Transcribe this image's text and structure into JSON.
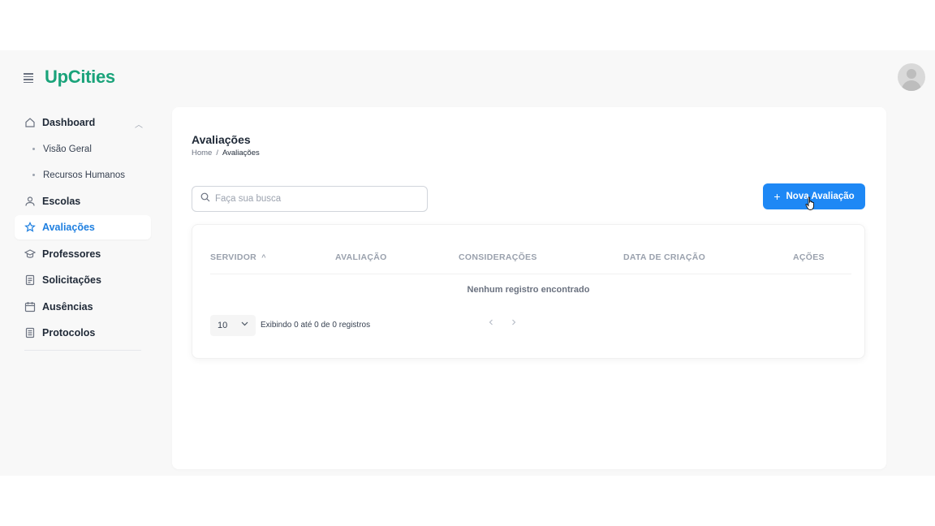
{
  "app": {
    "logo": "UpCities"
  },
  "sidebar": {
    "dashboard": {
      "label": "Dashboard",
      "children": [
        "Visão Geral",
        "Recursos Humanos"
      ]
    },
    "items": [
      {
        "label": "Escolas",
        "icon": "user-icon"
      },
      {
        "label": "Avaliações",
        "icon": "star-icon",
        "active": true
      },
      {
        "label": "Professores",
        "icon": "graduation-cap-icon"
      },
      {
        "label": "Solicitações",
        "icon": "document-icon"
      },
      {
        "label": "Ausências",
        "icon": "calendar-icon"
      },
      {
        "label": "Protocolos",
        "icon": "list-icon"
      }
    ]
  },
  "page": {
    "title": "Avaliações",
    "breadcrumb": {
      "home": "Home",
      "separator": "/",
      "current": "Avaliações"
    }
  },
  "search": {
    "placeholder": "Faça sua busca",
    "value": ""
  },
  "actions": {
    "new_label": "Nova Avaliação"
  },
  "table": {
    "columns": [
      "SERVIDOR",
      "AVALIAÇÃO",
      "CONSIDERAÇÕES",
      "DATA DE CRIAÇÃO",
      "AÇÕES"
    ],
    "sort_indicator": "^",
    "empty_message": "Nenhum registro encontrado",
    "page_size": "10",
    "info": "Exibindo 0 até 0 de 0 registros"
  },
  "colors": {
    "brand": "#1aa37a",
    "primary": "#1e88f5",
    "active_nav": "#1e7fe0"
  }
}
